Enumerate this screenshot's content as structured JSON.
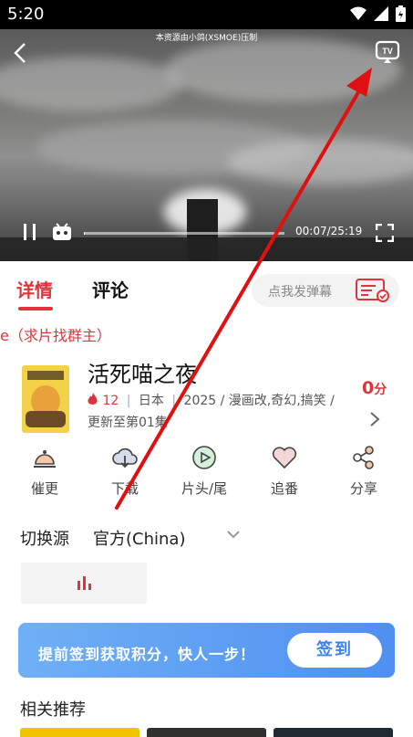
{
  "status_bar": {
    "time": "5:20"
  },
  "video": {
    "overlay_title": "本资源由小鸽(XSMOE)压制",
    "timecode": "00:07/25:19",
    "progress_fraction": 0.005
  },
  "tabs": {
    "details": "详情",
    "comments": "评论"
  },
  "danmaku": {
    "placeholder": "点我发弹幕"
  },
  "notice": "e（求片找群主）",
  "anime": {
    "title": "活死喵之夜",
    "hot": "12",
    "separator": "|",
    "region": "日本",
    "meta_rest": "2025 / 漫画改,奇幻,搞笑 /",
    "update": "更新至第01集",
    "score_value": "0",
    "score_unit": "分"
  },
  "actions": [
    {
      "label": "催更",
      "icon": "bell-icon"
    },
    {
      "label": "下载",
      "icon": "cloud-download-icon"
    },
    {
      "label": "片头/尾",
      "icon": "play-circle-icon"
    },
    {
      "label": "追番",
      "icon": "heart-icon"
    },
    {
      "label": "分享",
      "icon": "share-icon"
    }
  ],
  "source": {
    "label": "切换源",
    "value": "官方(China)"
  },
  "banner": {
    "text": "提前签到获取积分，快人一步！",
    "button": "签到"
  },
  "recommend": {
    "title": "相关推荐"
  },
  "colors": {
    "accent": "#e0333b",
    "banner_start": "#6fb0f5",
    "banner_end": "#4f8ff0",
    "arrow": "#e01010"
  }
}
